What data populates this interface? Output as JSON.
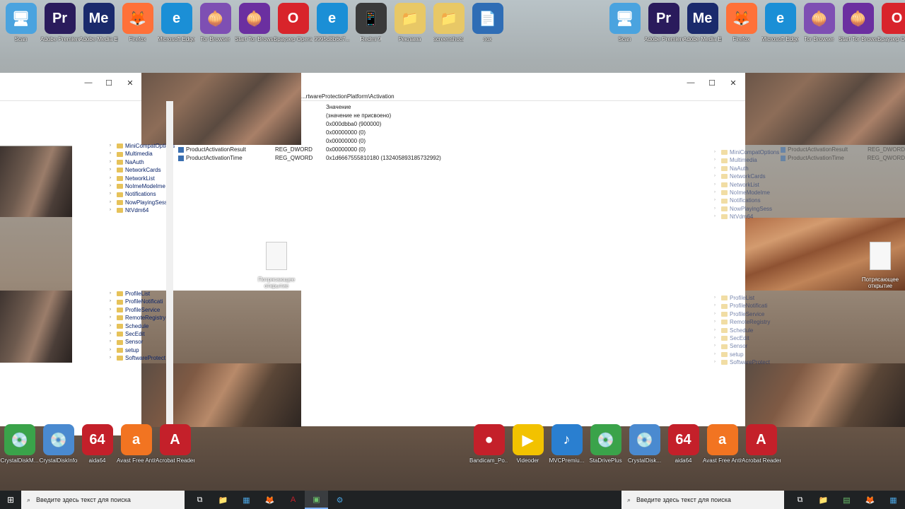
{
  "desktop_top_icons": [
    {
      "label": "Scan",
      "glyph": "🖥",
      "color": "#4aa3df"
    },
    {
      "label": "Adobe Premiere P...",
      "glyph": "Pr",
      "color": "#2a1b5c"
    },
    {
      "label": "Adobe Media Encoder 2020",
      "glyph": "Me",
      "color": "#1a2a6c"
    },
    {
      "label": "Firefox",
      "glyph": "🦊",
      "color": "#ff7139"
    },
    {
      "label": "Microsoft Edge",
      "glyph": "e",
      "color": "#1b8fd6"
    },
    {
      "label": "Tor Browser",
      "glyph": "🧅",
      "color": "#7e4fb3"
    },
    {
      "label": "Start Tor Browser",
      "glyph": "🧅",
      "color": "#6b2fa0"
    },
    {
      "label": "Браузер Opera",
      "glyph": "O",
      "color": "#d8242b"
    },
    {
      "label": "9995d8b6c7...",
      "glyph": "e",
      "color": "#1b8fd6"
    },
    {
      "label": "Redmi 9",
      "glyph": "📱",
      "color": "#3a3a3a"
    },
    {
      "label": "Реклама",
      "glyph": "📁",
      "color": "#e8c866"
    },
    {
      "label": "screenshots",
      "glyph": "📁",
      "color": "#e8c866"
    },
    {
      "label": "лох",
      "glyph": "📄",
      "color": "#2f6db5"
    }
  ],
  "desktop_right_icons": [
    {
      "label": "Scan",
      "glyph": "🖥",
      "color": "#4aa3df"
    },
    {
      "label": "Adobe Premiere P...",
      "glyph": "Pr",
      "color": "#2a1b5c"
    },
    {
      "label": "Adobe Media Encoder 2020",
      "glyph": "Me",
      "color": "#1a2a6c"
    },
    {
      "label": "Firefox",
      "glyph": "🦊",
      "color": "#ff7139"
    },
    {
      "label": "Microsoft Edge",
      "glyph": "e",
      "color": "#1b8fd6"
    },
    {
      "label": "Tor Browser",
      "glyph": "🧅",
      "color": "#7e4fb3"
    },
    {
      "label": "Start Tor Browser",
      "glyph": "🧅",
      "color": "#6b2fa0"
    },
    {
      "label": "Браузер Opera",
      "glyph": "O",
      "color": "#d8242b"
    }
  ],
  "desktop_bottom_icons": [
    {
      "label": "CrystalDiskM...",
      "glyph": "💿",
      "color": "#3aa34a"
    },
    {
      "label": "CrystalDiskInfo",
      "glyph": "💿",
      "color": "#4a8ad0"
    },
    {
      "label": "aida64",
      "glyph": "64",
      "color": "#c4202a"
    },
    {
      "label": "Avast Free Antivirus",
      "glyph": "a",
      "color": "#f27421"
    },
    {
      "label": "Acrobat Reader DC",
      "glyph": "A",
      "color": "#c4202a"
    }
  ],
  "desktop_bottom_right_icons": [
    {
      "label": "Bandicam_Po...",
      "glyph": "●",
      "color": "#c4202a"
    },
    {
      "label": "Videoder",
      "glyph": "▶",
      "color": "#f2c200"
    },
    {
      "label": "MVCPremiu...",
      "glyph": "♪",
      "color": "#2a7fd0"
    },
    {
      "label": "StaDrivePlus",
      "glyph": "💿",
      "color": "#3aa34a"
    },
    {
      "label": "CrystalDisk...",
      "glyph": "💿",
      "color": "#4a8ad0"
    },
    {
      "label": "aida64",
      "glyph": "64",
      "color": "#c4202a"
    },
    {
      "label": "Avast Free Antivirus",
      "glyph": "a",
      "color": "#f27421"
    },
    {
      "label": "Acrobat Reader DC",
      "glyph": "A",
      "color": "#c4202a"
    }
  ],
  "registry": {
    "address": "...rtwareProtectionPlatform\\Activation",
    "value_header": "Значение",
    "values": [
      "(значение не присвоено)",
      "0x000dbba0 (900000)",
      "0x00000000 (0)",
      "0x00000000 (0)",
      "0x00000000 (0)",
      "0x1d6667555810180 (132405893185732992)"
    ],
    "rows": [
      {
        "name": "ProductActivationResult",
        "type": "REG_DWORD"
      },
      {
        "name": "ProductActivationTime",
        "type": "REG_QWORD"
      }
    ],
    "tree_top": [
      "MiniCompatOptions",
      "Multimedia",
      "NaAuth",
      "NetworkCards",
      "NetworkList",
      "NoImeModeIme",
      "Notifications",
      "NowPlayingSess",
      "NtVdm64"
    ],
    "tree_bottom": [
      "ProfileList",
      "ProfileNotificati",
      "ProfileService",
      "RemoteRegistry",
      "Schedule",
      "SecEdit",
      "Sensor",
      "setup",
      "SoftwareProtect"
    ]
  },
  "file_label": "Потрясающее открытие",
  "window_controls": {
    "minimize": "—",
    "maximize": "☐",
    "close": "✕"
  },
  "taskbar": {
    "start_glyph": "⊞",
    "search_placeholder": "Введите здесь текст для поиска",
    "icons": [
      {
        "name": "task-view-icon",
        "glyph": "⧉",
        "color": "#fff"
      },
      {
        "name": "file-explorer-icon",
        "glyph": "📁",
        "color": "#e8c866"
      },
      {
        "name": "calculator-icon",
        "glyph": "▦",
        "color": "#4aa3df"
      },
      {
        "name": "firefox-icon",
        "glyph": "🦊",
        "color": "#ff7139"
      },
      {
        "name": "acrobat-icon",
        "glyph": "A",
        "color": "#c4202a"
      },
      {
        "name": "app-icon",
        "glyph": "▣",
        "color": "#6cc26c"
      },
      {
        "name": "regedit-icon",
        "glyph": "⚙",
        "color": "#4aa3df"
      }
    ],
    "right_icons": [
      {
        "name": "task-view-icon-2",
        "glyph": "⧉",
        "color": "#fff"
      },
      {
        "name": "file-explorer-icon-2",
        "glyph": "📁",
        "color": "#e8c866"
      },
      {
        "name": "app-icon-2",
        "glyph": "▤",
        "color": "#6cc26c"
      },
      {
        "name": "firefox-icon-2",
        "glyph": "🦊",
        "color": "#ff7139"
      },
      {
        "name": "app-icon-3",
        "glyph": "▦",
        "color": "#4aa3df"
      }
    ]
  }
}
